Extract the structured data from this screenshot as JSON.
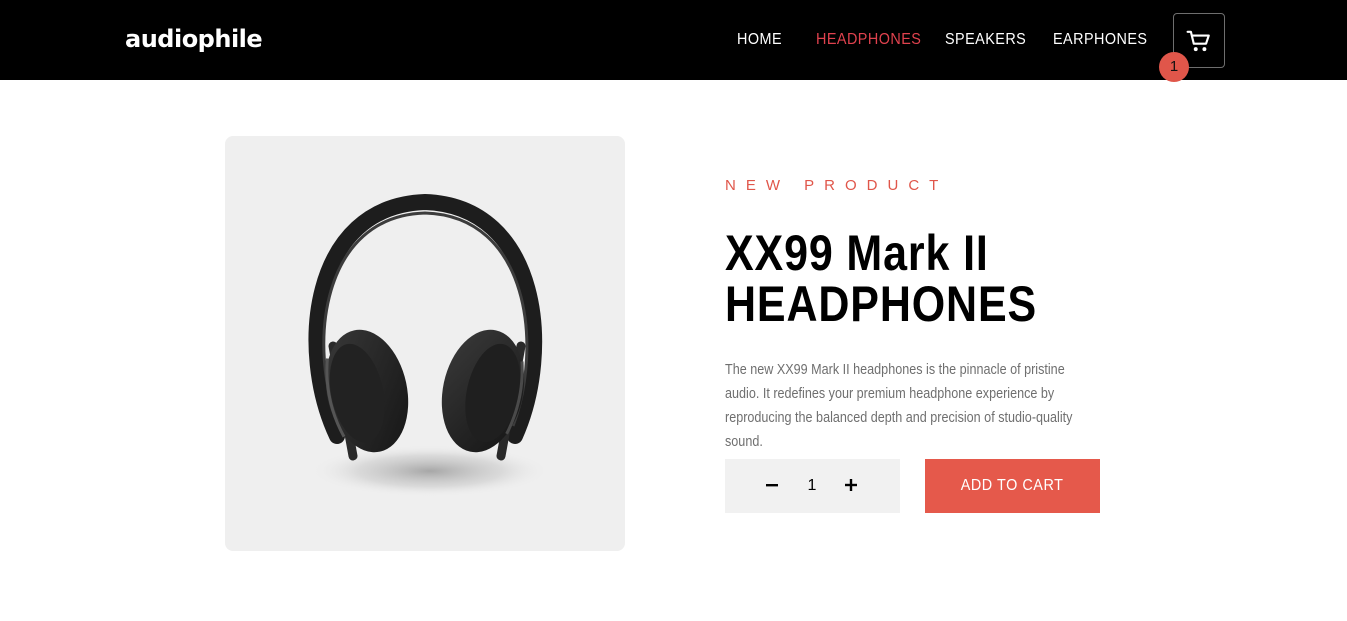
{
  "brand": {
    "logo": "audiophile"
  },
  "nav": {
    "links": [
      {
        "label": "HOME",
        "active": false
      },
      {
        "label": "HEADPHONES",
        "active": true
      },
      {
        "label": "SPEAKERS",
        "active": false
      },
      {
        "label": "EARPHONES",
        "active": false
      }
    ],
    "cart_count": "1",
    "cart_icon": "shopping-cart-icon"
  },
  "product": {
    "overline": "NEW PRODUCT",
    "title": "XX99 Mark II\nHEADPHONES",
    "description": "The new XX99 Mark II headphones is the pinnacle of pristine audio. It redefines your premium headphone experience by reproducing the balanced depth and precision of studio-quality sound.",
    "image_icon": "headphones-image"
  },
  "purchase": {
    "quantity": "1",
    "decrement_icon": "minus-icon",
    "increment_icon": "plus-icon",
    "add_to_cart_label": "ADD TO CART"
  },
  "colors": {
    "accent": "#e5594b",
    "active_nav": "#e0424e",
    "header_bg": "#000000",
    "card_bg": "#efefef"
  }
}
